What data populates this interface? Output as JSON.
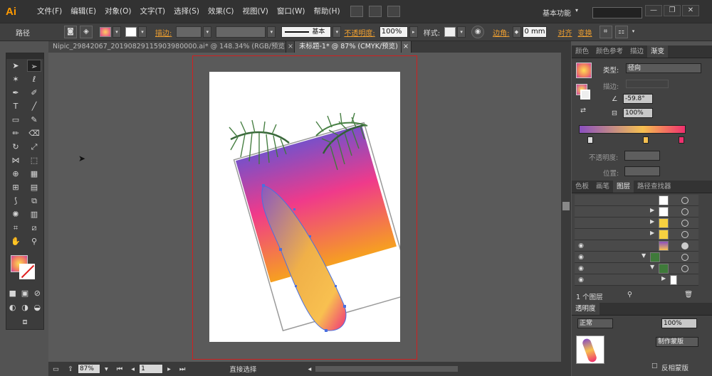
{
  "app": {
    "logo": "Ai",
    "workspace": "基本功能"
  },
  "menu": [
    "文件(F)",
    "编辑(E)",
    "对象(O)",
    "文字(T)",
    "选择(S)",
    "效果(C)",
    "视图(V)",
    "窗口(W)",
    "帮助(H)"
  ],
  "window_buttons": [
    "—",
    "❐",
    "✕"
  ],
  "control_bar": {
    "selection_label": "路径",
    "stroke_label": "描边:",
    "stroke_style": "基本",
    "opacity_label": "不透明度:",
    "opacity_value": "100%",
    "style_label": "样式:",
    "corner_label": "边角:",
    "corner_value": "0 mm",
    "align_label": "对齐",
    "transform_label": "变换"
  },
  "doc_tabs": [
    {
      "label": "Nipic_29842067_20190829115903980000.ai* @ 148.34% (RGB/预览)",
      "close": "×"
    },
    {
      "label": "未标题-1* @ 87% (CMYK/预览)",
      "close": "×"
    }
  ],
  "status_bar": {
    "zoom": "87%",
    "page": "1",
    "tool": "直接选择"
  },
  "color_panel": {
    "tabs": [
      "颜色",
      "颜色参考",
      "描边",
      "渐变"
    ],
    "type_label": "类型:",
    "type_value": "径向",
    "stroke_label": "描边:",
    "angle_value": "-59.8°",
    "aspect_value": "100%",
    "opacity_label": "不透明度:",
    "location_label": "位置:"
  },
  "layers_panel": {
    "tabs": [
      "色板",
      "画笔",
      "图层",
      "路径查找器"
    ],
    "layer_count": "1 个图层"
  },
  "transparency_panel": {
    "title": "透明度",
    "blend_label": "正常",
    "opacity_value": "100%",
    "make_mask": "制作蒙版",
    "invert_mask": "反相蒙版"
  },
  "colors": {
    "gradient_start": "#8a4fc0",
    "gradient_mid": "#f6c050",
    "gradient_end": "#f0306e",
    "artboard_guide": "#d02020",
    "accent_orange": "#ff9a00"
  }
}
